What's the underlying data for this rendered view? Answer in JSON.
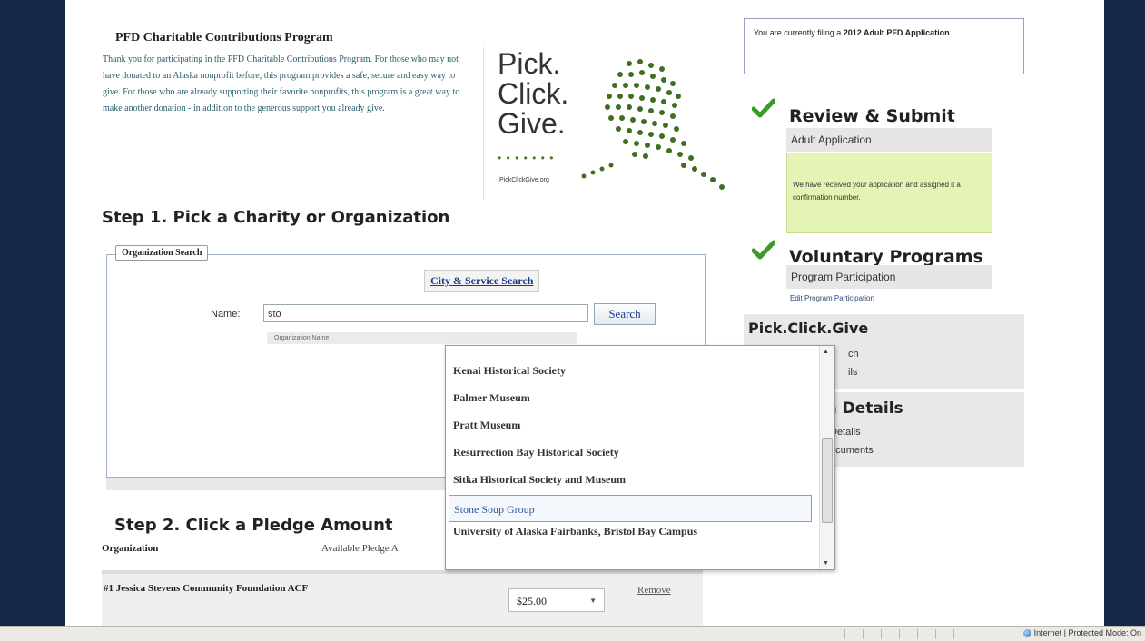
{
  "intro": {
    "title": "PFD Charitable Contributions Program",
    "text": "Thank you for participating in the PFD Charitable Contributions Program. For those who may not have donated to an Alaska nonprofit before, this program provides a safe, secure and easy way to give. For those who are already supporting their favorite nonprofits, this program is a great way to make another donation - in addition to the generous support you already give."
  },
  "logo": {
    "line1": "Pick.",
    "line2": "Click.",
    "line3": "Give.",
    "url": "PickClickGive.org"
  },
  "step1": {
    "heading": "Step 1. Pick a Charity or Organization",
    "legend": "Organization Search",
    "city_link": "City & Service Search",
    "name_label": "Name:",
    "name_value": "sto",
    "search_button": "Search",
    "hint": "Organization Name"
  },
  "dropdown": {
    "items": [
      {
        "label": "Kenai Historical Society"
      },
      {
        "label": "Palmer Museum"
      },
      {
        "label": "Pratt Museum"
      },
      {
        "label": "Resurrection Bay Historical Society"
      },
      {
        "label": "Sitka Historical Society and Museum"
      },
      {
        "label": "Stone Soup Group"
      },
      {
        "label": "University of Alaska Fairbanks, Bristol Bay Campus"
      }
    ],
    "selected": "Stone Soup Group"
  },
  "step2": {
    "heading": "Step 2. Click a Pledge Amount",
    "col_org": "Organization",
    "col_pledge": "Available Pledge A",
    "row": {
      "name": "#1 Jessica Stevens Community Foundation ACF",
      "amount": "$25.00",
      "remove": "Remove"
    }
  },
  "sidebar": {
    "filing_prefix": "You are currently filing a",
    "filing_bold": "2012 Adult PFD Application",
    "review_title": "Review & Submit",
    "review_sub": "Adult Application",
    "review_msg": "We have received your application and assigned it a confirmation number.",
    "voluntary_title": "Voluntary Programs",
    "voluntary_sub": "Program Participation",
    "voluntary_edit": "Edit Program Participation",
    "pcg_title": "Pick.Click.Give",
    "pcg_sub1": "ch",
    "pcg_sub2": "ils",
    "app_title": "tion Details",
    "app_sub1": "Details",
    "app_sub2": "ocuments"
  },
  "statusbar": {
    "zone": "Internet | Protected Mode: On"
  },
  "colors": {
    "frame": "#16284a",
    "link": "#1a3a8a",
    "check": "#3a9a2a",
    "confirmation_bg": "#e4f4b4"
  }
}
